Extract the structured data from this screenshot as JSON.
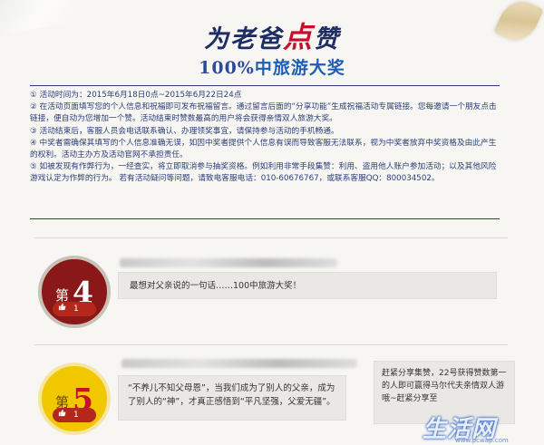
{
  "header": {
    "title_part1": "为老爸",
    "title_highlight": "点",
    "title_part2": "赞",
    "subtitle_num": "100%",
    "subtitle_text": "中旅游大奖"
  },
  "rules": [
    "① 活动时间为：2015年6月18日0点~2015年6月22日24点",
    "② 在活动页面填写您的个人信息和祝福即可发布祝福留言。通过留言后面的“分享功能”生成祝福活动专属链接。您每邀请一个朋友点击链接，便自动为您增加一个赞。活动结束时赞数最高的用户将会获得亲情双人旅游大奖。",
    "③ 活动结束后，客服人员会电话联系确认、办理领奖事宜，请保持参与活动的手机畅通。",
    "④ 中奖者需确保其填写的个人信息准确无误，如因中奖者提供个人信息有误而导致客服无法联系，视为中奖者放弃中奖资格及由此产生的权利。活动主办方及活动官网不承担责任。",
    "⑤ 如被发现有作弊行为，一经查实，将立即取消参与抽奖资格。例如利用非常手段集赞：利用、盗用他人账户参加活动；以及其他风险游戏认定为作弊的行为。 若有活动疑问等问题，请致电客服电话：010-60676767，或联系客服QQ：800034502。"
  ],
  "entries": [
    {
      "rank_prefix": "第",
      "rank": "4",
      "likes": "1",
      "comment": "最想对父亲说的一句话……100中旅游大奖！"
    },
    {
      "rank_prefix": "第",
      "rank": "5",
      "likes": "1",
      "comment": "“不养儿不知父母恩”，当我们成为了别人的父亲，成为了别人的“神”，才真正感悟到“平凡坚强，父爱无疆”。",
      "side_comment": "赶紧分享集赞，22号获得赞数第一的人即可赢得马尔代夫亲情双人游哦~赶紧分享至"
    }
  ],
  "watermark": {
    "text": "生活网",
    "url": "www.pcwap.com"
  },
  "icons": {
    "thumb": "thumbs-up-icon"
  },
  "colors": {
    "navy": "#1e2d63",
    "red": "#c8102e",
    "badge_dark": "#8a1818",
    "badge_gold": "#f1c800"
  }
}
